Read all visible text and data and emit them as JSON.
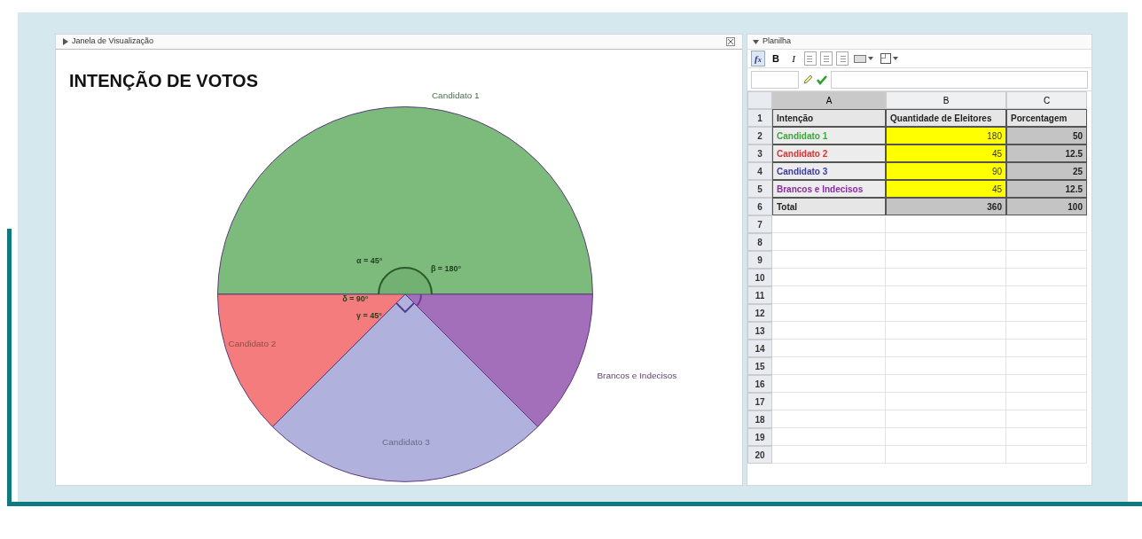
{
  "graphics_view": {
    "title": "Janela de Visualização",
    "heading": "INTENÇÃO DE VOTOS",
    "chart_data": {
      "type": "pie",
      "categories": [
        "Candidato 1",
        "Candidato 2",
        "Candidato 3",
        "Brancos e Indecisos"
      ],
      "values": [
        50,
        12.5,
        25,
        12.5
      ],
      "colors": [
        "#7dbb7d",
        "#f47c7c",
        "#b1b1dd",
        "#a46fba"
      ]
    },
    "angle_labels": [
      "α = 45°",
      "β = 180°",
      "δ = 90°",
      "γ = 45°"
    ]
  },
  "spreadsheet": {
    "title": "Planilha",
    "toolbar": [
      {
        "kind": "formula",
        "text": "f$_{x}$"
      },
      {
        "kind": "bold",
        "text": "B"
      },
      {
        "kind": "italic",
        "text": "I"
      },
      {
        "kind": "align-left"
      },
      {
        "kind": "align-center"
      },
      {
        "kind": "align-right"
      },
      {
        "kind": "fill-dropdown"
      },
      {
        "kind": "border-dropdown"
      }
    ],
    "columns": [
      {
        "label": "A",
        "selected": true
      },
      {
        "label": "B",
        "selected": false
      },
      {
        "label": "C",
        "selected": false
      }
    ],
    "rows": [
      {
        "number": "1",
        "cells": [
          {
            "text": "Intenção",
            "kind": "header"
          },
          {
            "text": "Quantidade de Eleitores",
            "kind": "header"
          },
          {
            "text": "Porcentagem",
            "kind": "header"
          }
        ]
      },
      {
        "number": "2",
        "cells": [
          {
            "text": "Candidato 1",
            "kind": "label",
            "color": "#3aa83a"
          },
          {
            "text": "180",
            "kind": "input"
          },
          {
            "text": "50",
            "kind": "computed"
          }
        ]
      },
      {
        "number": "3",
        "cells": [
          {
            "text": "Candidato 2",
            "kind": "label",
            "color": "#e03030"
          },
          {
            "text": "45",
            "kind": "input"
          },
          {
            "text": "12.5",
            "kind": "computed"
          }
        ]
      },
      {
        "number": "4",
        "cells": [
          {
            "text": "Candidato 3",
            "kind": "label",
            "color": "#3a3aa8"
          },
          {
            "text": "90",
            "kind": "input"
          },
          {
            "text": "25",
            "kind": "computed"
          }
        ]
      },
      {
        "number": "5",
        "cells": [
          {
            "text": "Brancos e Indecisos",
            "kind": "label",
            "color": "#8a2aa0"
          },
          {
            "text": "45",
            "kind": "input"
          },
          {
            "text": "12.5",
            "kind": "computed"
          }
        ]
      },
      {
        "number": "6",
        "cells": [
          {
            "text": "Total",
            "kind": "header"
          },
          {
            "text": "360",
            "kind": "computed"
          },
          {
            "text": "100",
            "kind": "computed"
          }
        ]
      },
      {
        "number": "7"
      },
      {
        "number": "8"
      },
      {
        "number": "9"
      },
      {
        "number": "10"
      },
      {
        "number": "11"
      },
      {
        "number": "12"
      },
      {
        "number": "13"
      },
      {
        "number": "14"
      },
      {
        "number": "15"
      },
      {
        "number": "16"
      },
      {
        "number": "17"
      },
      {
        "number": "18"
      },
      {
        "number": "19"
      },
      {
        "number": "20"
      }
    ]
  }
}
